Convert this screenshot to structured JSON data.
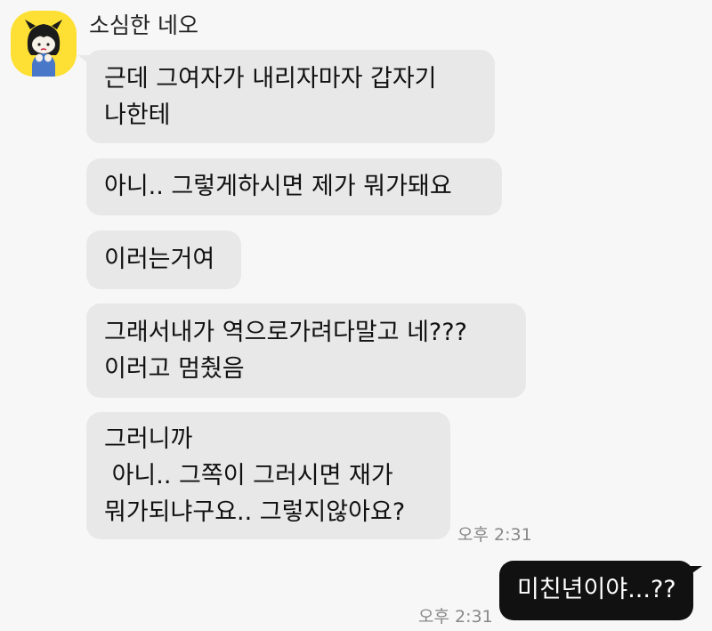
{
  "chat": {
    "sender": {
      "name": "소심한 네오",
      "avatar_icon": "neo-character-avatar-icon",
      "avatar_color": "#fde033"
    },
    "incoming_messages": [
      {
        "text": "근데 그여자가 내리자마자 갑자기\n나한테"
      },
      {
        "text": "아니.. 그렇게하시면 제가 뭐가돼요"
      },
      {
        "text": "이러는거여"
      },
      {
        "text": "그래서내가 역으로가려다말고 네???\n이러고 멈췄음"
      },
      {
        "text": "그러니까\n 아니.. 그쪽이 그러시면 재가\n뭐가되냐구요.. 그렇지않아요?"
      }
    ],
    "incoming_time": "오후 2:31",
    "outgoing_message": "미친년이야...??",
    "outgoing_time": "오후 2:31",
    "colors": {
      "background": "#f7f7f7",
      "incoming_bubble": "#e8e8e8",
      "outgoing_bubble": "#111111",
      "timestamp": "#888888"
    }
  }
}
